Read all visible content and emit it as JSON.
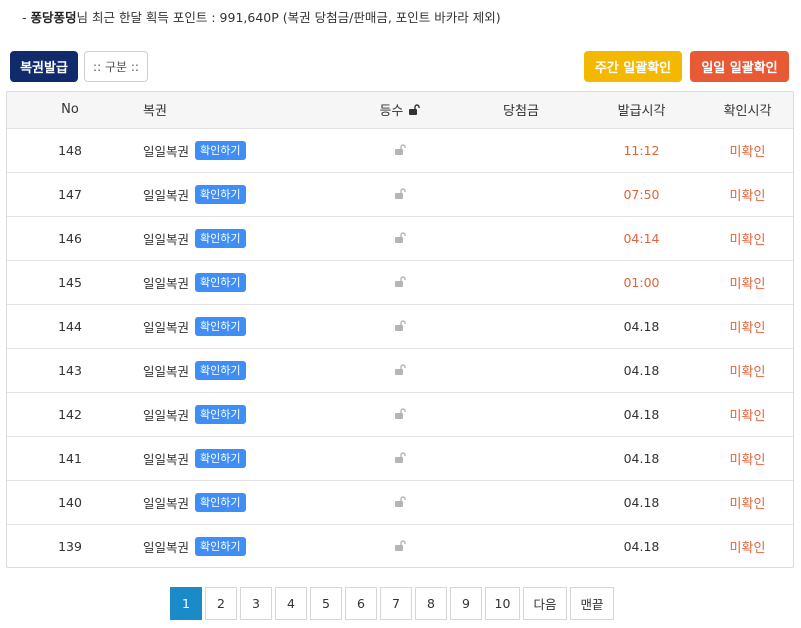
{
  "info": {
    "prefix": "- ",
    "username": "퐁당퐁덩",
    "text": "님 최근 한달 획득 포인트 : 991,640P (복권 당첨금/판매금, 포인트 바카라 제외)"
  },
  "toolbar": {
    "issue_label": "복권발급",
    "filter_label": ":: 구분 ::",
    "weekly_label": "주간 일괄확인",
    "daily_label": "일일 일괄확인"
  },
  "colors": {
    "issue": "#102a6b",
    "weekly": "#f5b800",
    "daily": "#e85a36",
    "badge": "#3f8ef5",
    "alert": "#e0643a",
    "pager_active": "#1a8ac8"
  },
  "table": {
    "headers": {
      "no": "No",
      "lottery": "복권",
      "grade": "등수",
      "prize": "당첨금",
      "issued": "발급시각",
      "checked": "확인시각"
    },
    "rows": [
      {
        "no": "148",
        "name": "일일복권",
        "badge": "확인하기",
        "prize": "",
        "issued": "11:12",
        "checked": "미확인",
        "issued_recent": true
      },
      {
        "no": "147",
        "name": "일일복권",
        "badge": "확인하기",
        "prize": "",
        "issued": "07:50",
        "checked": "미확인",
        "issued_recent": true
      },
      {
        "no": "146",
        "name": "일일복권",
        "badge": "확인하기",
        "prize": "",
        "issued": "04:14",
        "checked": "미확인",
        "issued_recent": true
      },
      {
        "no": "145",
        "name": "일일복권",
        "badge": "확인하기",
        "prize": "",
        "issued": "01:00",
        "checked": "미확인",
        "issued_recent": true
      },
      {
        "no": "144",
        "name": "일일복권",
        "badge": "확인하기",
        "prize": "",
        "issued": "04.18",
        "checked": "미확인",
        "issued_recent": false
      },
      {
        "no": "143",
        "name": "일일복권",
        "badge": "확인하기",
        "prize": "",
        "issued": "04.18",
        "checked": "미확인",
        "issued_recent": false
      },
      {
        "no": "142",
        "name": "일일복권",
        "badge": "확인하기",
        "prize": "",
        "issued": "04.18",
        "checked": "미확인",
        "issued_recent": false
      },
      {
        "no": "141",
        "name": "일일복권",
        "badge": "확인하기",
        "prize": "",
        "issued": "04.18",
        "checked": "미확인",
        "issued_recent": false
      },
      {
        "no": "140",
        "name": "일일복권",
        "badge": "확인하기",
        "prize": "",
        "issued": "04.18",
        "checked": "미확인",
        "issued_recent": false
      },
      {
        "no": "139",
        "name": "일일복권",
        "badge": "확인하기",
        "prize": "",
        "issued": "04.18",
        "checked": "미확인",
        "issued_recent": false
      }
    ]
  },
  "pagination": {
    "pages": [
      "1",
      "2",
      "3",
      "4",
      "5",
      "6",
      "7",
      "8",
      "9",
      "10"
    ],
    "current": "1",
    "next_label": "다음",
    "last_label": "맨끝"
  }
}
